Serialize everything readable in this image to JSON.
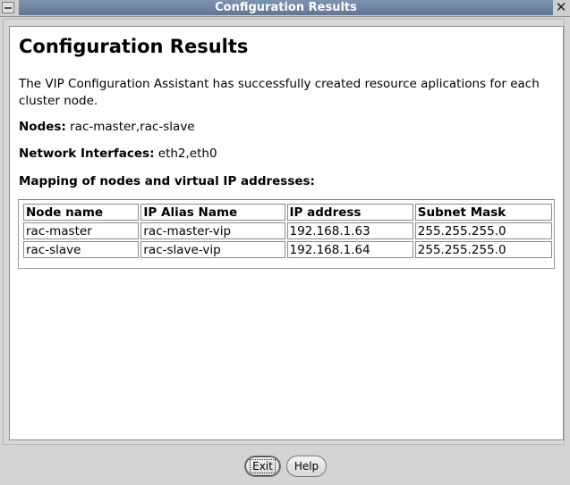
{
  "window": {
    "title": "Configuration Results"
  },
  "content": {
    "heading": "Configuration Results",
    "description": "The VIP Configuration Assistant has successfully created resource aplications for each cluster node.",
    "nodes_label": "Nodes:",
    "nodes_value": "rac-master,rac-slave",
    "interfaces_label": "Network Interfaces:",
    "interfaces_value": "eth2,eth0",
    "mapping_title": "Mapping of nodes and virtual IP addresses:"
  },
  "table": {
    "columns": [
      "Node name",
      "IP Alias Name",
      "IP address",
      "Subnet Mask"
    ],
    "rows": [
      [
        "rac-master",
        "rac-master-vip",
        "192.168.1.63",
        "255.255.255.0"
      ],
      [
        "rac-slave",
        "rac-slave-vip",
        "192.168.1.64",
        "255.255.255.0"
      ]
    ]
  },
  "buttons": {
    "exit": "Exit",
    "help": "Help"
  },
  "icons": {
    "window_menu": "window-menu-icon",
    "close": "close-icon"
  }
}
